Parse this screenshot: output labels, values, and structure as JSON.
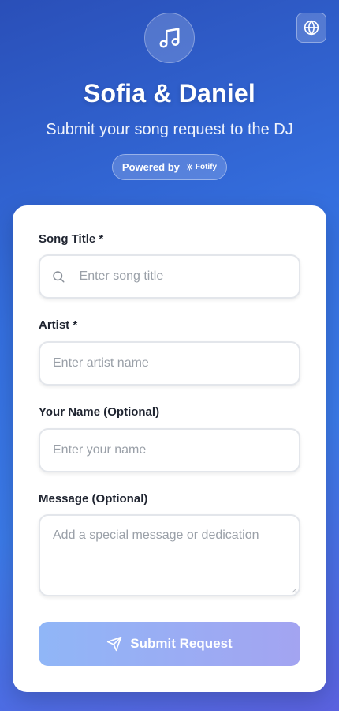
{
  "header": {
    "title": "Sofia & Daniel",
    "subtitle": "Submit your song request to the DJ",
    "powered_by": "Powered by",
    "brand": "Fotify",
    "logo_icon": "music-note-icon",
    "language_icon": "globe-icon"
  },
  "form": {
    "song_title": {
      "label": "Song Title *",
      "placeholder": "Enter song title",
      "value": ""
    },
    "artist": {
      "label": "Artist *",
      "placeholder": "Enter artist name",
      "value": ""
    },
    "your_name": {
      "label": "Your Name (Optional)",
      "placeholder": "Enter your name",
      "value": ""
    },
    "message": {
      "label": "Message (Optional)",
      "placeholder": "Add a special message or dedication",
      "value": ""
    },
    "submit_label": "Submit Request"
  },
  "colors": {
    "accent": "#3b7ae8",
    "submit_gradient_start": "#90b6f7",
    "submit_gradient_end": "#a3a4f1"
  }
}
